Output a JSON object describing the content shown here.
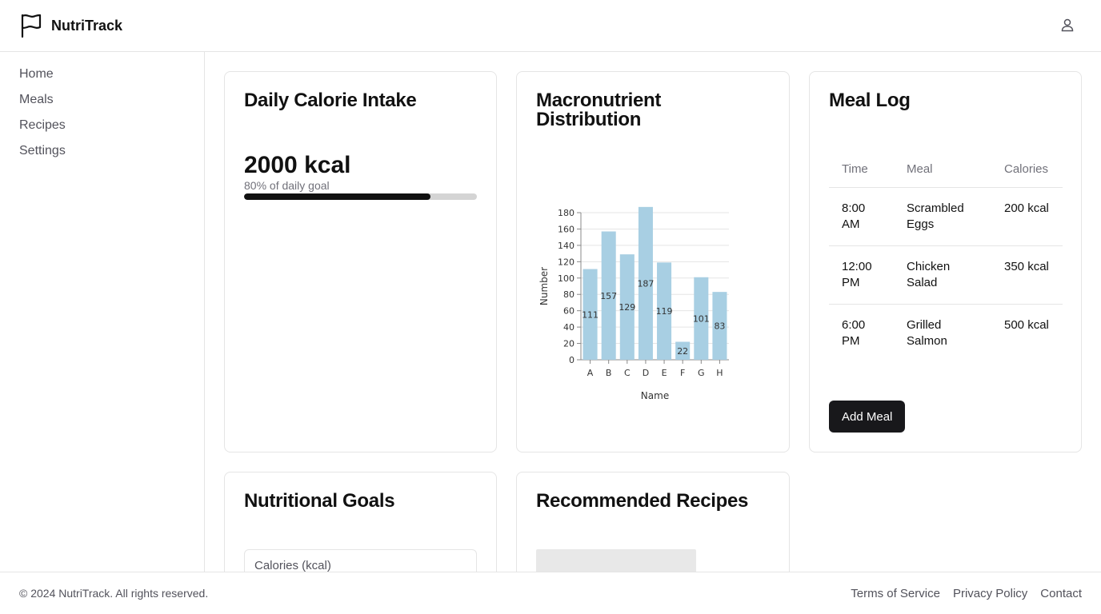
{
  "app": {
    "brand": "NutriTrack",
    "logo_icon": "flag-icon",
    "user_icon": "user-icon"
  },
  "sidebar": {
    "items": [
      {
        "label": "Home"
      },
      {
        "label": "Meals"
      },
      {
        "label": "Recipes"
      },
      {
        "label": "Settings"
      }
    ]
  },
  "calorie_card": {
    "title": "Daily Calorie Intake",
    "value": "2000 kcal",
    "subtitle": "80% of daily goal",
    "progress_percent": 80
  },
  "macro_card": {
    "title": "Macronutrient Distribution"
  },
  "chart_data": {
    "type": "bar",
    "categories": [
      "A",
      "B",
      "C",
      "D",
      "E",
      "F",
      "G",
      "H"
    ],
    "values": [
      111,
      157,
      129,
      187,
      119,
      22,
      101,
      83
    ],
    "xlabel": "Name",
    "ylabel": "Number",
    "ylim": [
      0,
      180
    ],
    "yticks": [
      0,
      20,
      40,
      60,
      80,
      100,
      120,
      140,
      160,
      180
    ],
    "bar_color": "#a8cfe3",
    "grid": true
  },
  "meal_card": {
    "title": "Meal Log",
    "columns": [
      "Time",
      "Meal",
      "Calories"
    ],
    "rows": [
      [
        "8:00 AM",
        "Scrambled Eggs",
        "200 kcal"
      ],
      [
        "12:00 PM",
        "Chicken Salad",
        "350 kcal"
      ],
      [
        "6:00 PM",
        "Grilled Salmon",
        "500 kcal"
      ]
    ],
    "add_label": "Add Meal"
  },
  "goals_card": {
    "title": "Nutritional Goals",
    "calories_placeholder": "Calories (kcal)"
  },
  "recipes_card": {
    "title": "Recommended Recipes"
  },
  "footer": {
    "copyright": "© 2024 NutriTrack. All rights reserved.",
    "links": [
      {
        "label": "Terms of Service"
      },
      {
        "label": "Privacy Policy"
      },
      {
        "label": "Contact"
      }
    ]
  }
}
